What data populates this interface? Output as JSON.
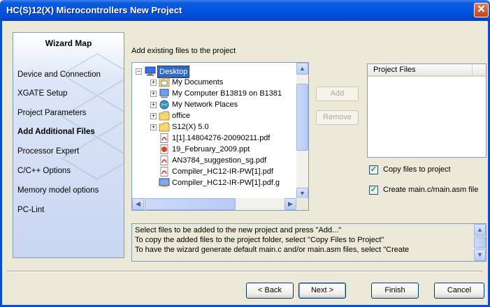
{
  "window": {
    "title": "HC(S)12(X) Microcontrollers New Project"
  },
  "wizard_map": {
    "title": "Wizard Map",
    "items": [
      {
        "label": "Device and Connection",
        "active": false
      },
      {
        "label": "XGATE Setup",
        "active": false
      },
      {
        "label": "Project Parameters",
        "active": false
      },
      {
        "label": "Add Additional Files",
        "active": true
      },
      {
        "label": "Processor Expert",
        "active": false
      },
      {
        "label": "C/C++ Options",
        "active": false
      },
      {
        "label": "Memory model options",
        "active": false
      },
      {
        "label": "PC-Lint",
        "active": false
      }
    ]
  },
  "main": {
    "heading": "Add existing files to the project"
  },
  "tree": {
    "root": "Desktop",
    "items": [
      {
        "label": "My Documents",
        "icon": "my-documents-icon"
      },
      {
        "label": "My Computer B13819 on B1381",
        "icon": "my-computer-icon"
      },
      {
        "label": "My Network Places",
        "icon": "network-places-icon"
      },
      {
        "label": "office",
        "icon": "folder-icon"
      },
      {
        "label": "S12(X) 5.0",
        "icon": "folder-icon"
      },
      {
        "label": "1[1].14804276-20090211.pdf",
        "icon": "pdf-file-icon"
      },
      {
        "label": "19_February_2009.ppt",
        "icon": "ppt-file-icon"
      },
      {
        "label": "AN3784_suggestion_sg.pdf",
        "icon": "pdf-file-icon"
      },
      {
        "label": "Compiler_HC12-IR-PW[1].pdf",
        "icon": "pdf-file-icon"
      },
      {
        "label": "Compiler_HC12-IR-PW[1].pdf.g",
        "icon": "generic-file-icon"
      }
    ]
  },
  "buttons": {
    "add": "Add",
    "remove": "Remove",
    "back": "< Back",
    "next": "Next >",
    "finish": "Finish",
    "cancel": "Cancel"
  },
  "project_files": {
    "header": "Project Files"
  },
  "checkboxes": {
    "copy_files": {
      "label": "Copy files to project",
      "checked": true
    },
    "create_main": {
      "label": "Create main.c/main.asm file",
      "checked": true
    }
  },
  "info": {
    "lines": [
      "Select files to be added to the new project and press \"Add...\"",
      "To copy the added files to the project folder, select \"Copy Files to Project\"",
      "To have the wizard generate default main.c and/or main.asm files, select \"Create"
    ]
  },
  "colors": {
    "title_bar": "#0554e3",
    "selection": "#316ac5",
    "panel_bg": "#ece9d8",
    "close_button": "#d3582f"
  }
}
